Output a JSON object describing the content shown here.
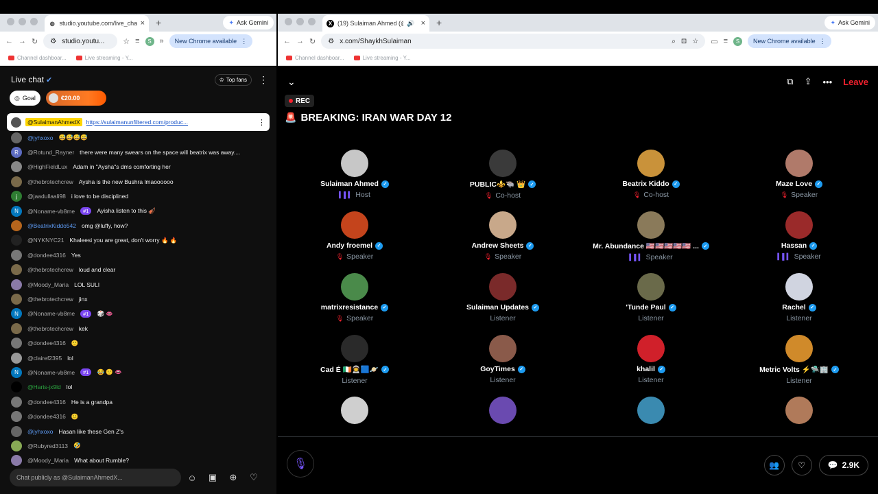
{
  "left_window": {
    "tab_title": "studio.youtube.com/live_cha",
    "new_tab": "+",
    "ask_gemini": "Ask Gemini",
    "address": "studio.youtu...",
    "new_chrome": "New Chrome available",
    "profile": "S",
    "bookmarks": [
      "Channel dashboar...",
      "Live streaming - Y..."
    ],
    "live_chat_title": "Live chat",
    "top_fans": "Top fans",
    "goal": "Goal",
    "goal_amount": "€20.00",
    "pinned": {
      "name": "@SulaimanAhmedX",
      "link": "https://sulaimanunfiltered.com/produc..."
    },
    "messages": [
      {
        "name": "@jyhxoxo",
        "text": "😅😅😅😅",
        "color": "blue",
        "av": "#666"
      },
      {
        "name": "@Rotund_Rayner",
        "text": "there were many swears on the space will beatrix was away....",
        "av": "#5c6bc0",
        "initial": "R"
      },
      {
        "name": "@HighFieldLux",
        "text": "Adam in \"Aysha\"s dms comforting her",
        "av": "#888"
      },
      {
        "name": "@thebrotechcrew",
        "text": "Aysha is the new Bushra lmaoooooo",
        "av": "#7a6a4a"
      },
      {
        "name": "@jaadullaali98",
        "text": "i love to be disciplined",
        "av": "#2e7d32",
        "initial": "j"
      },
      {
        "name": "@Noname-vb8me",
        "text": "Ayisha listen to this 🎻",
        "badge": "#1",
        "av": "#0277bd",
        "initial": "N"
      },
      {
        "name": "@BeatrixKiddo542",
        "text": "omg @luffy, how?",
        "color": "blue",
        "av": "#b5651d"
      },
      {
        "name": "@NYKNYC21",
        "text": "Khaleesi you are great, don't worry 🔥 🔥",
        "av": "#222"
      },
      {
        "name": "@dondee4316",
        "text": "Yes",
        "av": "#777"
      },
      {
        "name": "@thebrotechcrew",
        "text": "loud and clear",
        "av": "#7a6a4a"
      },
      {
        "name": "@Moody_Maria",
        "text": "LOL SULI",
        "av": "#8a7aa8"
      },
      {
        "name": "@thebrotechcrew",
        "text": "jinx",
        "av": "#7a6a4a"
      },
      {
        "name": "@Noname-vb8me",
        "text": "🎲 👄",
        "badge": "#1",
        "av": "#0277bd",
        "initial": "N"
      },
      {
        "name": "@thebrotechcrew",
        "text": "kek",
        "av": "#7a6a4a"
      },
      {
        "name": "@dondee4316",
        "text": "🙂",
        "av": "#777"
      },
      {
        "name": "@clairef2395",
        "text": "lol",
        "av": "#999"
      },
      {
        "name": "@Noname-vb8me",
        "text": "😂 🙂 👄",
        "badge": "#1",
        "av": "#0277bd",
        "initial": "N"
      },
      {
        "name": "@Haris-jx9ld",
        "text": "lol",
        "color": "green",
        "av": "#000"
      },
      {
        "name": "@dondee4316",
        "text": "He is a grandpa",
        "av": "#777"
      },
      {
        "name": "@dondee4316",
        "text": "🙂",
        "av": "#777"
      },
      {
        "name": "@jyhxoxo",
        "text": "Hasan like these Gen Z's",
        "color": "blue",
        "av": "#666"
      },
      {
        "name": "@Rubyred3113",
        "text": "🤣",
        "av": "#8a5"
      },
      {
        "name": "@Moody_Maria",
        "text": "What about Rumble?",
        "av": "#8a7aa8"
      }
    ],
    "chat_placeholder": "Chat publicly as @SulaimanAhmedX..."
  },
  "right_window": {
    "tab_title": "(19) Sulaiman Ahmed (@S",
    "new_tab": "+",
    "ask_gemini": "Ask Gemini",
    "address": "x.com/ShaykhSulaiman",
    "new_chrome": "New Chrome available",
    "profile": "S",
    "bookmarks": [
      "Channel dashboar...",
      "Live streaming - Y..."
    ],
    "leave": "Leave",
    "rec": "REC",
    "title": "BREAKING: IRAN WAR DAY 12",
    "participants": [
      {
        "name": "Sulaiman Ahmed",
        "role": "Host",
        "ico": "speaking",
        "av": "#c7c7c7"
      },
      {
        "name": "PUBLIC⚜️🐃 👑",
        "role": "Co-host",
        "ico": "muted",
        "av": "#3a3a3a"
      },
      {
        "name": "Beatrix Kiddo",
        "role": "Co-host",
        "ico": "muted",
        "av": "#c9923a"
      },
      {
        "name": "Maze Love",
        "role": "Speaker",
        "ico": "muted",
        "av": "#b07a6a"
      },
      {
        "name": "Andy froemel",
        "role": "Speaker",
        "ico": "muted",
        "av": "#c4441c"
      },
      {
        "name": "Andrew Sheets",
        "role": "Speaker",
        "ico": "muted",
        "av": "#c8a88a"
      },
      {
        "name": "Mr. Abundance 🇺🇸🇺🇸🇺🇸🇺🇸🇺🇸 ...",
        "role": "Speaker",
        "ico": "speaking",
        "av": "#8a7a5a"
      },
      {
        "name": "Hassan",
        "role": "Speaker",
        "ico": "speaking",
        "av": "#9a2a2a"
      },
      {
        "name": "matrixresistance",
        "role": "Speaker",
        "ico": "muted",
        "av": "#4a8a4a"
      },
      {
        "name": "Sulaiman Updates",
        "role": "Listener",
        "ico": "",
        "av": "#7a2a2a"
      },
      {
        "name": "'Tunde Paul",
        "role": "Listener",
        "ico": "",
        "av": "#6a6a4a"
      },
      {
        "name": "Rachel",
        "role": "Listener",
        "ico": "",
        "av": "#d0d4e0"
      },
      {
        "name": "Cad É 🇮🇪👨‍🚀🟦🪐",
        "role": "Listener",
        "ico": "",
        "av": "#2a2a2a"
      },
      {
        "name": "GoyTimes",
        "role": "Listener",
        "ico": "",
        "av": "#8a5a4a"
      },
      {
        "name": "khalil",
        "role": "Listener",
        "ico": "",
        "av": "#d0202a"
      },
      {
        "name": "Metric Volts ⚡🛸🏢",
        "role": "Listener",
        "ico": "",
        "av": "#d08a2a"
      },
      {
        "name": "",
        "role": "",
        "ico": "",
        "av": "#cfcfcf"
      },
      {
        "name": "",
        "role": "",
        "ico": "",
        "av": "#6a4ab0"
      },
      {
        "name": "",
        "role": "",
        "ico": "",
        "av": "#3a8ab0"
      },
      {
        "name": "",
        "role": "",
        "ico": "",
        "av": "#b07a5a"
      }
    ],
    "reply_count": "2.9K"
  }
}
